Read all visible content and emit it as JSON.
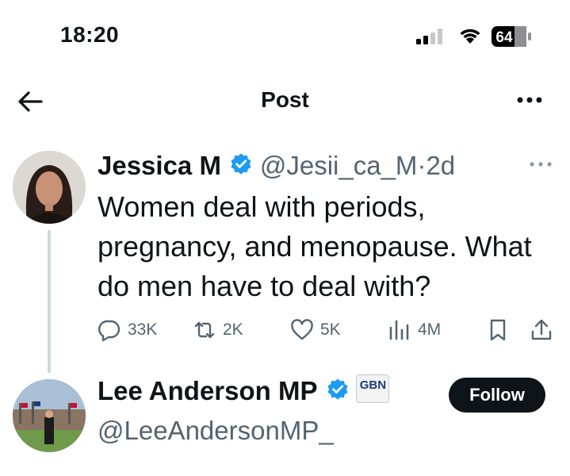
{
  "status_bar": {
    "time": "18:20",
    "battery": "64"
  },
  "header": {
    "title": "Post"
  },
  "tweets": [
    {
      "name": "Jessica M",
      "handle": "@Jesii_ca_M",
      "separator": "·",
      "age": "2d",
      "text": "Women deal with periods, pregnancy, and menopause. What do men have to deal with?",
      "replies": "33K",
      "reposts": "2K",
      "likes": "5K",
      "views": "4M"
    },
    {
      "name": "Lee Anderson MP",
      "handle": "@LeeAndersonMP_",
      "affiliation": "GBN",
      "follow_label": "Follow"
    }
  ],
  "colors": {
    "verified": "#1d9bf0",
    "text": "#0f1419",
    "muted": "#536471",
    "line": "#cfd9de"
  }
}
